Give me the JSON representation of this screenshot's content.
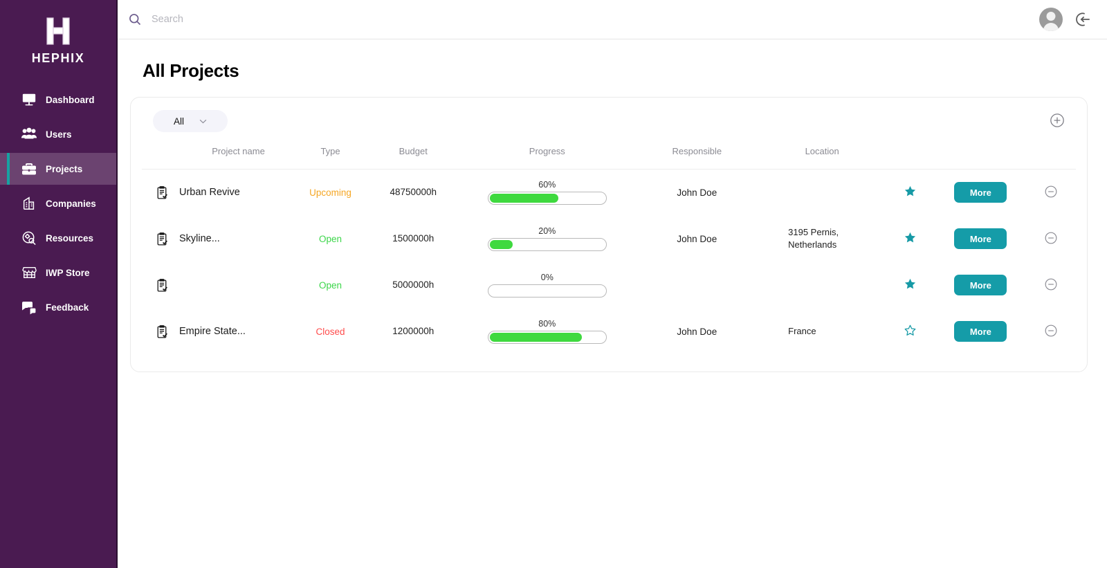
{
  "brand": {
    "logo_text": "HEPHIX",
    "logo_letter": "H",
    "sidebar_bg": "#4A1B51",
    "active_bg": "#6B4370",
    "accent": "#17A2A2"
  },
  "sidebar": {
    "items": [
      {
        "label": "Dashboard",
        "icon": "presentation-board-icon",
        "active": false
      },
      {
        "label": "Users",
        "icon": "users-group-icon",
        "active": false
      },
      {
        "label": "Projects",
        "icon": "briefcase-icon",
        "active": true
      },
      {
        "label": "Companies",
        "icon": "office-building-icon",
        "active": false
      },
      {
        "label": "Resources",
        "icon": "gear-search-icon",
        "active": false
      },
      {
        "label": "IWP Store",
        "icon": "storefront-icon",
        "active": false
      },
      {
        "label": "Feedback",
        "icon": "chat-bubbles-icon",
        "active": false
      }
    ]
  },
  "topbar": {
    "search_placeholder": "Search",
    "search_value": "",
    "search_icon": "search-icon",
    "avatar_icon": "user-avatar",
    "logout_icon": "logout-icon"
  },
  "page": {
    "title": "All Projects"
  },
  "toolbar": {
    "filter_value": "All",
    "filter_chevron": "chevron-down-icon",
    "add_icon": "plus-circle-icon"
  },
  "table": {
    "columns": [
      "Project name",
      "Type",
      "Budget",
      "Progress",
      "Responsible",
      "Location",
      "",
      "",
      ""
    ],
    "more_label": "More",
    "row_icon": "clipboard-check-icon",
    "star_filled_icon": "star-filled-icon",
    "star_outline_icon": "star-outline-icon",
    "delete_icon": "minus-circle-icon",
    "rows": [
      {
        "name": "Urban Revive",
        "type": "Upcoming",
        "type_color": "#F5A623",
        "budget": "48750000h",
        "progress": 60,
        "progress_label": "60%",
        "responsible": "John Doe",
        "location": "",
        "starred": true
      },
      {
        "name": "Skyline...",
        "type": "Open",
        "type_color": "#3CD64A",
        "budget": "1500000h",
        "progress": 20,
        "progress_label": "20%",
        "responsible": "John Doe",
        "location": "3195 Pernis, Netherlands",
        "starred": true
      },
      {
        "name": "",
        "type": "Open",
        "type_color": "#3CD64A",
        "budget": "5000000h",
        "progress": 0,
        "progress_label": "0%",
        "responsible": "",
        "location": "",
        "starred": true
      },
      {
        "name": "Empire State...",
        "type": "Closed",
        "type_color": "#FF4C4C",
        "budget": "1200000h",
        "progress": 80,
        "progress_label": "80%",
        "responsible": "John Doe",
        "location": "France",
        "starred": false
      }
    ]
  }
}
